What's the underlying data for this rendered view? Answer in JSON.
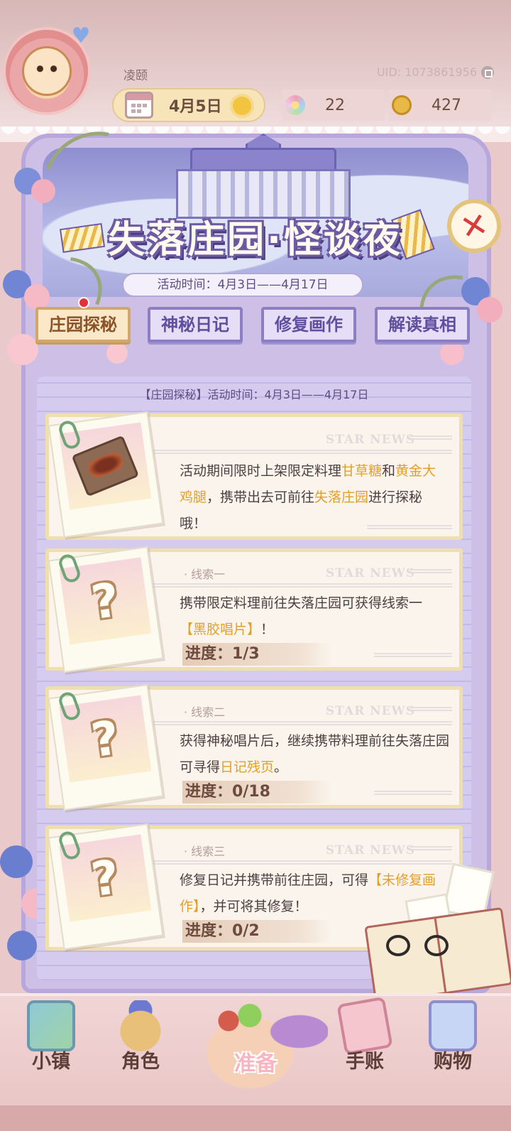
{
  "player": {
    "name": "凌颐",
    "uid": "UID: 1073861956"
  },
  "status": {
    "date": "4月5日",
    "weather_icon": "sun-icon",
    "flowers": "22",
    "coins": "427"
  },
  "event": {
    "title": "失落庄园·怪谈夜",
    "time": "活动时间：4月3日——4月17日"
  },
  "tabs": [
    {
      "label": "庄园探秘",
      "active": true
    },
    {
      "label": "神秘日记",
      "active": false
    },
    {
      "label": "修复画作",
      "active": false
    },
    {
      "label": "解读真相",
      "active": false
    }
  ],
  "section": {
    "header": "【庄园探秘】活动时间：4月3日——4月17日"
  },
  "cards": [
    {
      "star_news": "STAR NEWS",
      "text_parts": [
        "活动期间限时上架限定料理",
        "甘草糖",
        "和",
        "黄金大鸡腿",
        "，携带出去可前往",
        "失落庄园",
        "进行探秘哦！"
      ]
    },
    {
      "label": "· 线索一",
      "star_news": "STAR NEWS",
      "text_parts": [
        "携带限定料理前往失落庄园可获得线索一",
        "【黑胶唱片】",
        "！"
      ],
      "progress": "进度：1/3"
    },
    {
      "label": "· 线索二",
      "star_news": "STAR NEWS",
      "text_parts": [
        "获得神秘唱片后，继续携带料理前往失落庄园可寻得",
        "日记残页",
        "。"
      ],
      "progress": "进度：0/18"
    },
    {
      "label": "· 线索三",
      "star_news": "STAR NEWS",
      "text_parts": [
        "修复日记并携带前往庄园，可得",
        "【未修复画作】",
        "，并可将其修复！"
      ],
      "progress": "进度：0/2"
    }
  ],
  "nav": [
    {
      "label": "小镇",
      "icon": "map-icon"
    },
    {
      "label": "角色",
      "icon": "character-icon"
    },
    {
      "label": "准备",
      "icon": "prepare-icon",
      "active": true
    },
    {
      "label": "手账",
      "icon": "journal-icon"
    },
    {
      "label": "购物",
      "icon": "shopping-bag-icon"
    }
  ],
  "colors": {
    "highlight": "#e2a02a",
    "panel": "#cdbfe6",
    "tab_active": "#fbe8c9"
  }
}
